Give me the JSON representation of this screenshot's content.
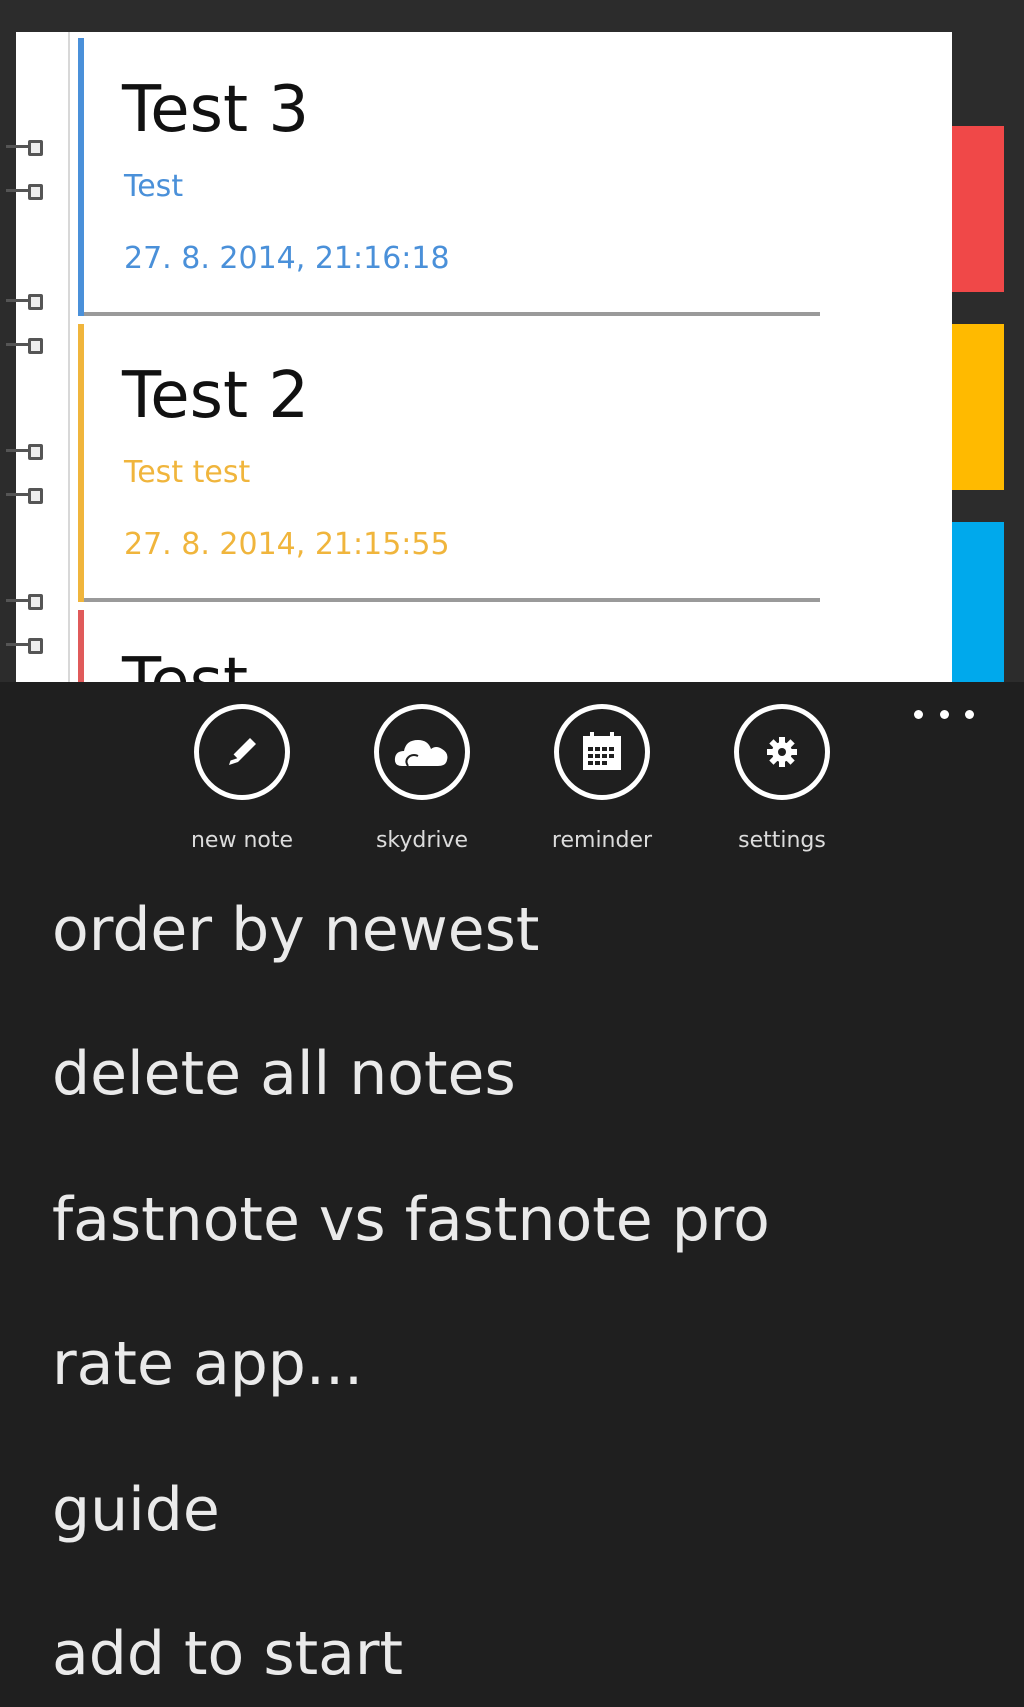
{
  "notes": [
    {
      "title": "Test 3",
      "body": "Test",
      "date": "27. 8. 2014, 21:16:18",
      "color": "#4a90d9"
    },
    {
      "title": "Test 2",
      "body": "Test test",
      "date": "27. 8. 2014, 21:15:55",
      "color": "#f0b53c"
    },
    {
      "title": "Test",
      "body": "",
      "date": "",
      "color": "#e05a5a"
    }
  ],
  "tabs": [
    {
      "name": "red",
      "color": "#f04848"
    },
    {
      "name": "yellow",
      "color": "#ffba00"
    },
    {
      "name": "blue",
      "color": "#00a9ec"
    }
  ],
  "appbar": {
    "buttons": [
      {
        "label": "new note",
        "icon": "pencil-icon"
      },
      {
        "label": "skydrive",
        "icon": "cloud-icon"
      },
      {
        "label": "reminder",
        "icon": "calendar-icon"
      },
      {
        "label": "settings",
        "icon": "gear-icon"
      }
    ],
    "menu": [
      "order by newest",
      "delete all notes",
      "fastnote vs fastnote pro",
      "rate app...",
      "guide",
      "add to start"
    ]
  }
}
